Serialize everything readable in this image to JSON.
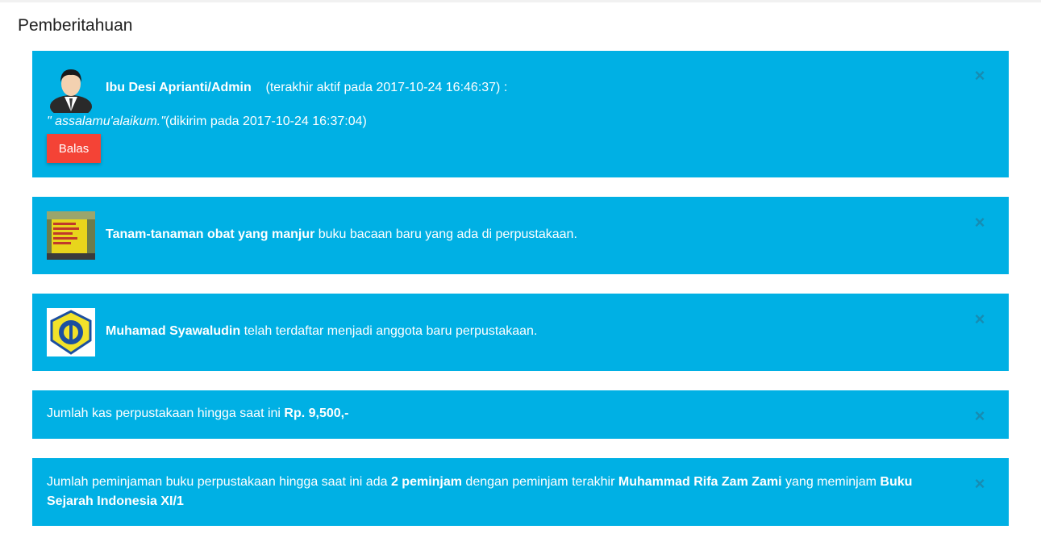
{
  "page_title": "Pemberitahuan",
  "close_glyph": "×",
  "alerts": {
    "message": {
      "sender": "Ibu Desi Aprianti/Admin",
      "last_active": "(terakhir aktif pada 2017-10-24 16:46:37) :",
      "quote": "\" assalamu'alaikum.\"",
      "sent_at": "(dikirim pada 2017-10-24 16:37:04)",
      "reply_label": "Balas",
      "avatar_icon": "user-avatar-icon"
    },
    "new_book": {
      "title": "Tanam-tanaman obat yang manjur",
      "text": " buku bacaan baru yang ada di perpustakaan.",
      "thumb_icon": "book-cover-thumbnail"
    },
    "new_member": {
      "name": "Muhamad Syawaludin",
      "text": " telah terdaftar menjadi anggota baru perpustakaan.",
      "thumb_icon": "school-logo"
    },
    "cash": {
      "text": "Jumlah kas perpustakaan hingga saat ini ",
      "amount": "Rp. 9,500,-"
    },
    "loans": {
      "text1": "Jumlah peminjaman buku perpustakaan hingga saat ini ada ",
      "count": "2 peminjam",
      "text2": " dengan peminjam terakhir ",
      "borrower": "Muhammad Rifa Zam Zami",
      "text3": " yang meminjam ",
      "book": "Buku Sejarah Indonesia XI/1"
    }
  },
  "colors": {
    "alert_bg": "#00b0e4",
    "reply_button": "#f44336"
  }
}
